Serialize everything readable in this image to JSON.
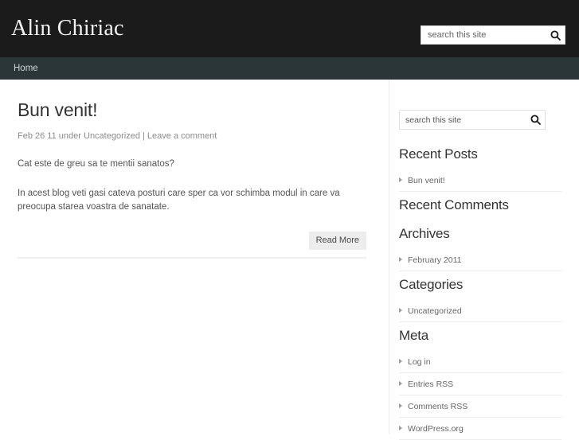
{
  "header": {
    "site_title": "Alin Chiriac",
    "search": {
      "placeholder": "search this site",
      "value": "",
      "icon": "search-icon"
    }
  },
  "nav": {
    "items": [
      {
        "label": "Home"
      }
    ]
  },
  "main": {
    "post": {
      "title": "Bun venit!",
      "meta": {
        "date": "Feb 26 11",
        "under_label": "under",
        "category": "Uncategorized",
        "separator": "|",
        "comments_link": "Leave a comment"
      },
      "paragraphs": [
        "Cat este de greu sa te mentii sanatos?",
        "In acest blog veti gasi cateva posturi care sper ca vor schimba modul in care va preocupa starea voastra de sanatate."
      ],
      "read_more_label": "Read More"
    }
  },
  "sidebar": {
    "search": {
      "placeholder": "search this site",
      "value": "",
      "icon": "search-icon"
    },
    "widgets": [
      {
        "title": "Recent Posts",
        "items": [
          {
            "label": "Bun venit!"
          }
        ]
      },
      {
        "title": "Recent Comments",
        "items": []
      },
      {
        "title": "Archives",
        "items": [
          {
            "label": "February 2011"
          }
        ]
      },
      {
        "title": "Categories",
        "items": [
          {
            "label": "Uncategorized"
          }
        ]
      },
      {
        "title": "Meta",
        "items": [
          {
            "label": "Log in"
          },
          {
            "label": "Entries RSS"
          },
          {
            "label": "Comments RSS"
          },
          {
            "label": "WordPress.org"
          }
        ]
      }
    ]
  },
  "colors": {
    "header_bg": "#1b1b1b",
    "nav_bg": "#2b3638",
    "page_bg": "#ffffff",
    "title_text": "#f2f2f2",
    "body_text": "#555555",
    "muted_text": "#8b8b8b",
    "button_bg": "#ededed",
    "divider": "#ededed"
  }
}
